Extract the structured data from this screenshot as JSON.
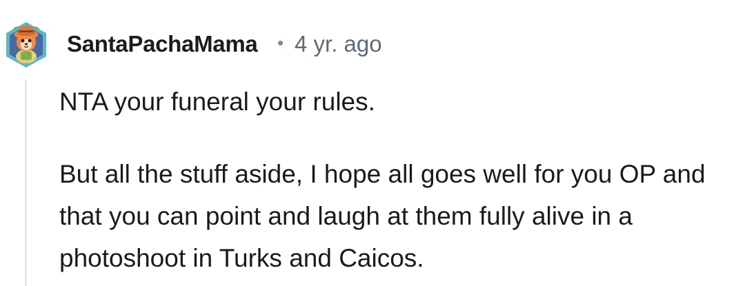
{
  "comment": {
    "author": {
      "username": "SantaPachaMama",
      "avatar_icon": "snoo-avatar-hexagon-icon"
    },
    "separator": "•",
    "timestamp": "4 yr. ago",
    "body": {
      "paragraphs": [
        "NTA your funeral your rules.",
        "But all the stuff aside, I hope all goes well for you OP and that you can point and laugh at them fully alive in a photoshoot in Turks and Caicos."
      ]
    }
  },
  "colors": {
    "username": "#1c1c1c",
    "timestamp": "#5c6b75",
    "thread_line": "#e6e8ea",
    "avatar_frame": "#5fb7c6",
    "avatar_bg": "#4a6aa0"
  }
}
